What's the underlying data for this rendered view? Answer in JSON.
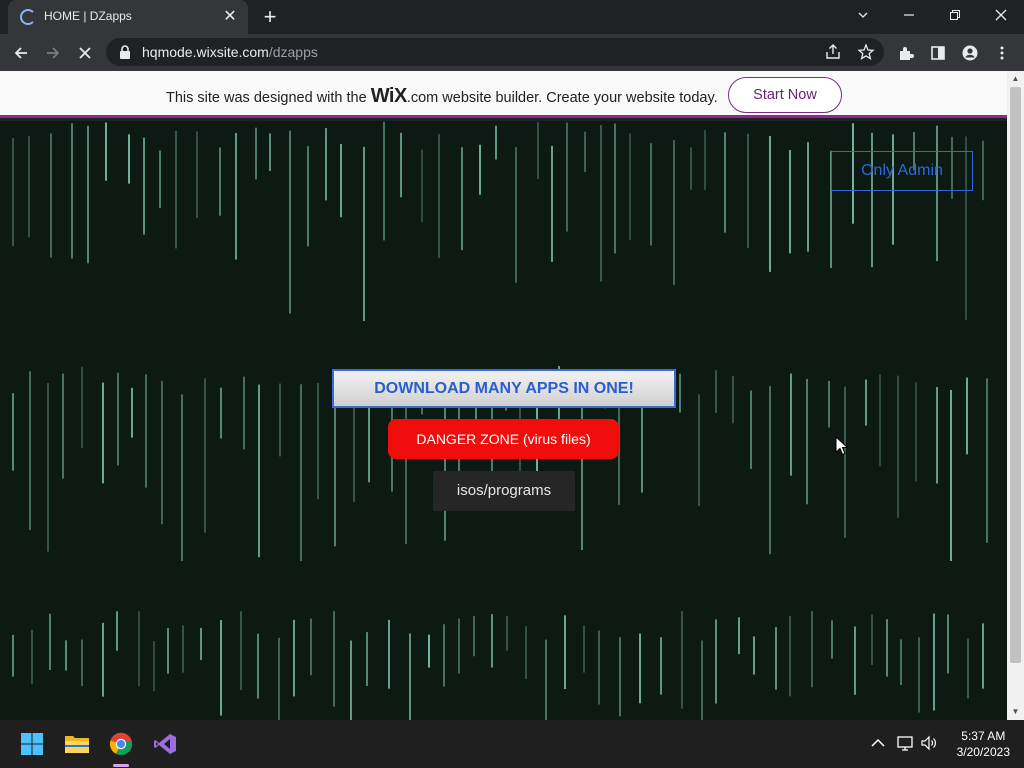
{
  "browser": {
    "tab_title": "HOME | DZapps",
    "url_host": "hqmode.wixsite.com",
    "url_path": "/dzapps"
  },
  "wix_banner": {
    "text_before": "This site was designed with the",
    "logo": "WiX",
    "text_after": ".com website builder. Create your website today.",
    "cta": "Start Now"
  },
  "page": {
    "admin_button": "Only Admin",
    "download_button": "DOWNLOAD MANY APPS IN ONE!",
    "danger_button": "DANGER ZONE (virus files)",
    "isos_button": "isos/programs",
    "colors": {
      "background": "#0d1a14",
      "danger": "#f20d0d",
      "link_blue": "#2f68d4",
      "rain": "#8fd9c4"
    }
  },
  "taskbar": {
    "apps": [
      "windows-start-icon",
      "file-explorer-icon",
      "chrome-icon",
      "visual-studio-icon"
    ],
    "time": "5:37 AM",
    "date": "3/20/2023"
  }
}
